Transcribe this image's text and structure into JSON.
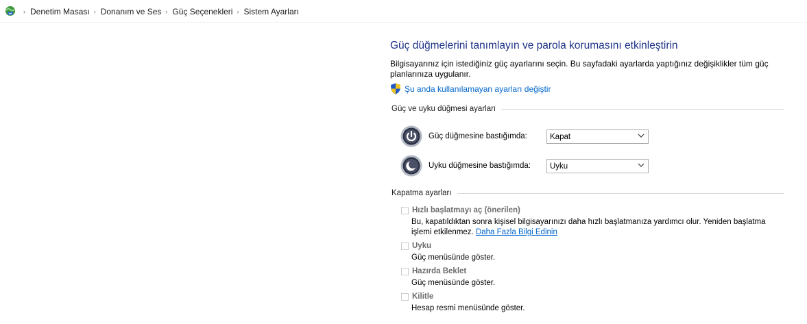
{
  "breadcrumb": {
    "items": [
      "Denetim Masası",
      "Donanım ve Ses",
      "Güç Seçenekleri",
      "Sistem Ayarları"
    ],
    "separator": "›"
  },
  "page": {
    "title": "Güç düğmelerini tanımlayın ve parola korumasını etkinleştirin",
    "description": "Bilgisayarınız için istediğiniz güç ayarlarını seçin. Bu sayfadaki ayarlarda yaptığınız değişiklikler tüm güç planlarınıza uygulanır.",
    "admin_link": "Şu anda kullanılamayan ayarları değiştir"
  },
  "power_buttons": {
    "heading": "Güç ve uyku düğmesi ayarları",
    "power": {
      "label": "Güç düğmesine bastığımda:",
      "value": "Kapat",
      "icon": "power-button-icon"
    },
    "sleep": {
      "label": "Uyku düğmesine bastığımda:",
      "value": "Uyku",
      "icon": "sleep-button-icon"
    }
  },
  "shutdown": {
    "heading": "Kapatma ayarları",
    "fast_startup": {
      "title": "Hızlı başlatmayı aç (önerilen)",
      "desc": "Bu, kapatıldıktan sonra kişisel bilgisayarınızı daha hızlı başlatmanıza yardımcı olur. Yeniden başlatma işlemi etkilenmez.",
      "link": "Daha Fazla Bilgi Edinin",
      "checked": false
    },
    "sleep": {
      "title": "Uyku",
      "desc": "Güç menüsünde göster.",
      "checked": false
    },
    "hibernate": {
      "title": "Hazırda Beklet",
      "desc": "Güç menüsünde göster.",
      "checked": false
    },
    "lock": {
      "title": "Kilitle",
      "desc": "Hesap resmi menüsünde göster.",
      "checked": false
    }
  },
  "colors": {
    "title": "#1e3287",
    "link": "#0066cc",
    "disabled_text": "#6d6d6d"
  }
}
